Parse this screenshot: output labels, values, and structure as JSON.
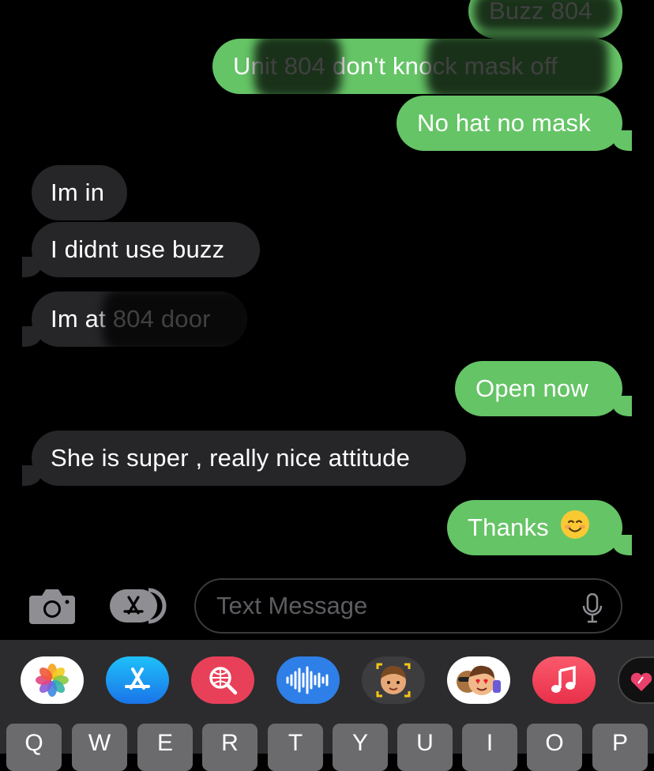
{
  "messages": [
    {
      "direction": "sent",
      "text": "Buzz 804"
    },
    {
      "direction": "sent",
      "text": "Unit 804 don't knock mask off"
    },
    {
      "direction": "sent",
      "text": "No hat no mask"
    },
    {
      "direction": "received",
      "text": "Im in"
    },
    {
      "direction": "received",
      "text": "I didnt use buzz"
    },
    {
      "direction": "received",
      "text": "Im at 804 door"
    },
    {
      "direction": "sent",
      "text": "Open now"
    },
    {
      "direction": "received",
      "text": "She is super , really nice attitude"
    },
    {
      "direction": "sent",
      "text": "Thanks"
    }
  ],
  "input": {
    "placeholder": "Text Message"
  },
  "app_drawer": {
    "apps": [
      "photos-icon",
      "app-store-icon",
      "search-web-icon",
      "audio-message-icon",
      "memoji-stickers-icon",
      "animoji-icon",
      "music-icon",
      "heart-stickers-icon"
    ]
  },
  "keyboard": {
    "keys": [
      "Q",
      "W",
      "E",
      "R",
      "T",
      "Y",
      "U",
      "I",
      "O",
      "P"
    ]
  },
  "colors": {
    "sent": "#65c466",
    "received": "#262629",
    "background": "#000000",
    "drawer": "#2c2c2e"
  }
}
